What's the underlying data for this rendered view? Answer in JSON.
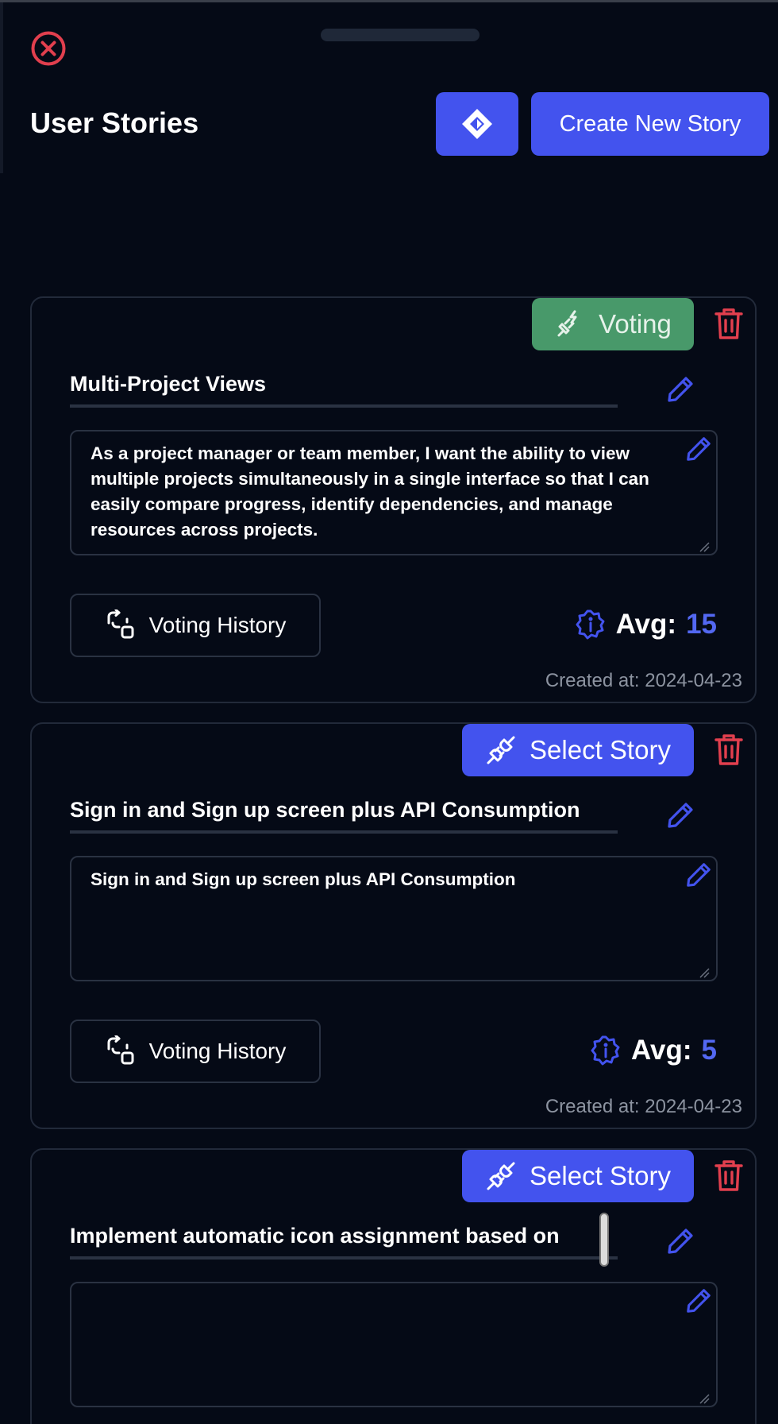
{
  "header": {
    "title": "User Stories",
    "create_label": "Create New Story"
  },
  "stories": [
    {
      "status": "Voting",
      "title": "Multi-Project Views",
      "description": "As a project manager or team member, I want the ability to view multiple projects simultaneously in a single interface so that I can easily compare progress, identify dependencies, and manage resources across projects.",
      "history_label": "Voting History",
      "avg_label": "Avg:",
      "avg_value": "15",
      "created": "Created at: 2024-04-23"
    },
    {
      "status": "Select Story",
      "title": "Sign in and Sign up screen plus API Consumption",
      "description": "Sign in and Sign up screen plus API Consumption",
      "history_label": "Voting History",
      "avg_label": "Avg:",
      "avg_value": "5",
      "created": "Created at: 2024-04-23"
    },
    {
      "status": "Select Story",
      "title": "Implement automatic icon assignment based on",
      "description": ""
    }
  ],
  "colors": {
    "background": "#050a16",
    "primary": "#4353ee",
    "voting": "#48996a",
    "danger": "#e23f4e",
    "accent_value": "#5368f2",
    "muted_text": "#8c93a0"
  },
  "icons": {
    "close": "close-circle-icon",
    "jira": "jira-diamond-icon",
    "voting": "plug-disconnected-icon",
    "select": "plug-connected-icon",
    "trash": "trash-icon",
    "edit": "pencil-icon",
    "history": "history-swap-icon",
    "info": "info-badge-icon"
  }
}
